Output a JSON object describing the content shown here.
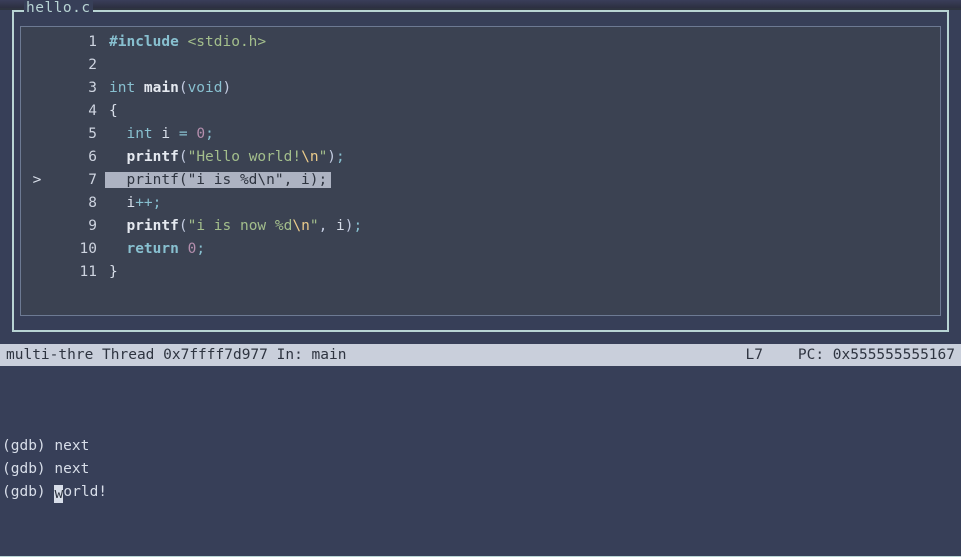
{
  "file_title": "hello.c",
  "code": {
    "current_line": 7,
    "lines": [
      {
        "n": 1,
        "tokens": [
          [
            "kw1 bold",
            "#include "
          ],
          [
            "hdr",
            "<stdio.h>"
          ]
        ]
      },
      {
        "n": 2,
        "tokens": []
      },
      {
        "n": 3,
        "tokens": [
          [
            "typ",
            "int "
          ],
          [
            "fn bold",
            "main"
          ],
          [
            "pn",
            "("
          ],
          [
            "typ",
            "void"
          ],
          [
            "pn",
            ")"
          ]
        ]
      },
      {
        "n": 4,
        "tokens": [
          [
            "br",
            "{"
          ]
        ]
      },
      {
        "n": 5,
        "tokens": [
          [
            "id",
            "  "
          ],
          [
            "typ",
            "int "
          ],
          [
            "id",
            "i "
          ],
          [
            "op",
            "= "
          ],
          [
            "num",
            "0"
          ],
          [
            "sc",
            ";"
          ]
        ]
      },
      {
        "n": 6,
        "tokens": [
          [
            "id",
            "  "
          ],
          [
            "fn bold",
            "printf"
          ],
          [
            "pn",
            "("
          ],
          [
            "str",
            "\"Hello world!"
          ],
          [
            "esc",
            "\\n"
          ],
          [
            "str",
            "\""
          ],
          [
            "pn",
            ")"
          ],
          [
            "sc",
            ";"
          ]
        ]
      },
      {
        "n": 7,
        "raw": "  printf(\"i is %d\\n\", i);"
      },
      {
        "n": 8,
        "tokens": [
          [
            "id",
            "  i"
          ],
          [
            "op",
            "++"
          ],
          [
            "sc",
            ";"
          ]
        ]
      },
      {
        "n": 9,
        "tokens": [
          [
            "id",
            "  "
          ],
          [
            "fn bold",
            "printf"
          ],
          [
            "pn",
            "("
          ],
          [
            "str",
            "\"i is now %d"
          ],
          [
            "esc",
            "\\n"
          ],
          [
            "str",
            "\""
          ],
          [
            "pn",
            ", "
          ],
          [
            "id",
            "i"
          ],
          [
            "pn",
            ")"
          ],
          [
            "sc",
            ";"
          ]
        ]
      },
      {
        "n": 10,
        "tokens": [
          [
            "id",
            "  "
          ],
          [
            "kw1 bold",
            "return "
          ],
          [
            "num",
            "0"
          ],
          [
            "sc",
            ";"
          ]
        ]
      },
      {
        "n": 11,
        "tokens": [
          [
            "br",
            "}"
          ]
        ]
      }
    ]
  },
  "status": {
    "left": "multi-thre Thread 0x7ffff7d977 In: main",
    "line_label": "L7",
    "pc_label": "PC: 0x555555555167"
  },
  "console": {
    "lines": [
      {
        "prompt": "(gdb) ",
        "text": "next"
      },
      {
        "prompt": "(gdb) ",
        "text": "next"
      },
      {
        "prompt": "(gdb) ",
        "cursor_char": "w",
        "after": "orld!"
      }
    ]
  }
}
